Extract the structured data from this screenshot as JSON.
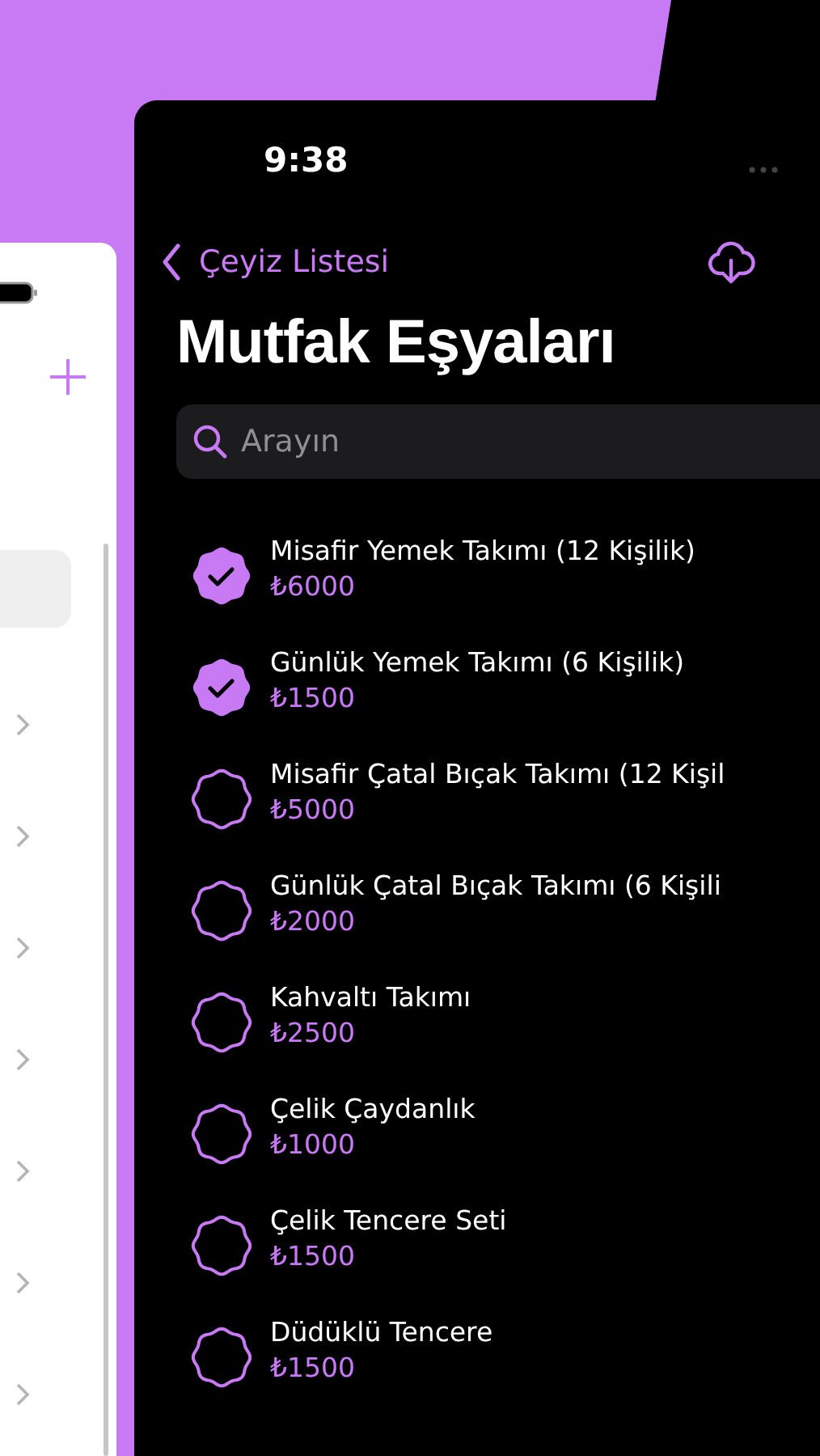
{
  "back_panel": {
    "rows": [
      {
        "selected": true
      },
      {
        "selected": false
      },
      {
        "selected": false
      },
      {
        "selected": false
      },
      {
        "selected": false
      },
      {
        "selected": false
      },
      {
        "selected": false
      },
      {
        "selected": false
      }
    ]
  },
  "status_bar": {
    "time": "9:38"
  },
  "nav": {
    "back_label": "Çeyiz Listesi"
  },
  "title": "Mutfak Eşyaları",
  "search": {
    "placeholder": "Arayın"
  },
  "items": [
    {
      "name": "Misafir Yemek Takımı (12 Kişilik)",
      "price": "₺6000",
      "checked": true
    },
    {
      "name": "Günlük Yemek Takımı (6 Kişilik)",
      "price": "₺1500",
      "checked": true
    },
    {
      "name": "Misafir Çatal Bıçak Takımı (12 Kişil",
      "price": "₺5000",
      "checked": false
    },
    {
      "name": "Günlük Çatal Bıçak Takımı (6 Kişili",
      "price": "₺2000",
      "checked": false
    },
    {
      "name": "Kahvaltı Takımı",
      "price": "₺2500",
      "checked": false
    },
    {
      "name": "Çelik Çaydanlık",
      "price": "₺1000",
      "checked": false
    },
    {
      "name": "Çelik Tencere Seti",
      "price": "₺1500",
      "checked": false
    },
    {
      "name": "Düdüklü Tencere",
      "price": "₺1500",
      "checked": false
    }
  ]
}
